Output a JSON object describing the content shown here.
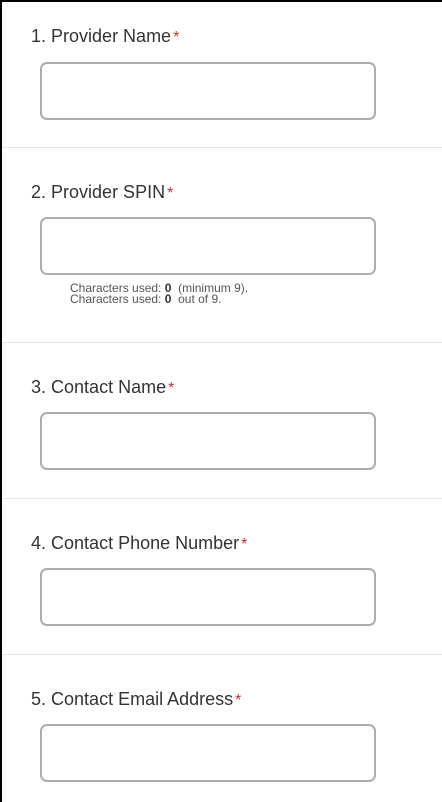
{
  "form": {
    "questions": [
      {
        "number": "1.",
        "label": "Provider Name",
        "required_mark": "*",
        "value": ""
      },
      {
        "number": "2.",
        "label": "Provider SPIN",
        "required_mark": "*",
        "value": ""
      },
      {
        "number": "3.",
        "label": "Contact Name",
        "required_mark": "*",
        "value": ""
      },
      {
        "number": "4.",
        "label": "Contact Phone Number",
        "required_mark": "*",
        "value": ""
      },
      {
        "number": "5.",
        "label": "Contact Email Address",
        "required_mark": "*",
        "value": ""
      }
    ],
    "spin_counter": {
      "line1_prefix": "Characters used:",
      "line1_count": "0",
      "line1_suffix": "(minimum 9).",
      "line2_prefix": "Characters used:",
      "line2_count": "0",
      "line2_suffix": "out of 9."
    }
  },
  "colors": {
    "required": "#c9302c",
    "input_border": "#adadad",
    "divider": "#e5e5e5",
    "text": "#333333"
  }
}
